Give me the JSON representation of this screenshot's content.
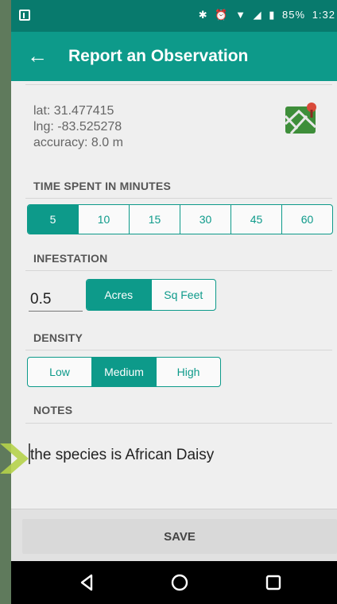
{
  "statusbar": {
    "battery": "85%",
    "time": "1:32"
  },
  "appbar": {
    "title": "Report an Observation"
  },
  "location": {
    "lat": "lat: 31.477415",
    "lng": "lng: -83.525278",
    "accuracy": "accuracy: 8.0 m"
  },
  "time_spent": {
    "label": "TIME SPENT IN MINUTES",
    "options": [
      "5",
      "10",
      "15",
      "30",
      "45",
      "60"
    ],
    "selected": "5"
  },
  "infestation": {
    "label": "INFESTATION",
    "value": "0.5",
    "units": [
      "Acres",
      "Sq Feet"
    ],
    "selected_unit": "Acres"
  },
  "density": {
    "label": "DENSITY",
    "options": [
      "Low",
      "Medium",
      "High"
    ],
    "selected": "Medium"
  },
  "notes": {
    "label": "NOTES",
    "text": "the species is African Daisy"
  },
  "actions": {
    "save_label": "SAVE"
  },
  "colors": {
    "accent": "#0d9a8a",
    "statusbar": "#087a6d"
  },
  "icons": [
    "map-pin-icon",
    "back-arrow-icon",
    "nav-back-icon",
    "nav-home-icon",
    "nav-recents-icon"
  ]
}
